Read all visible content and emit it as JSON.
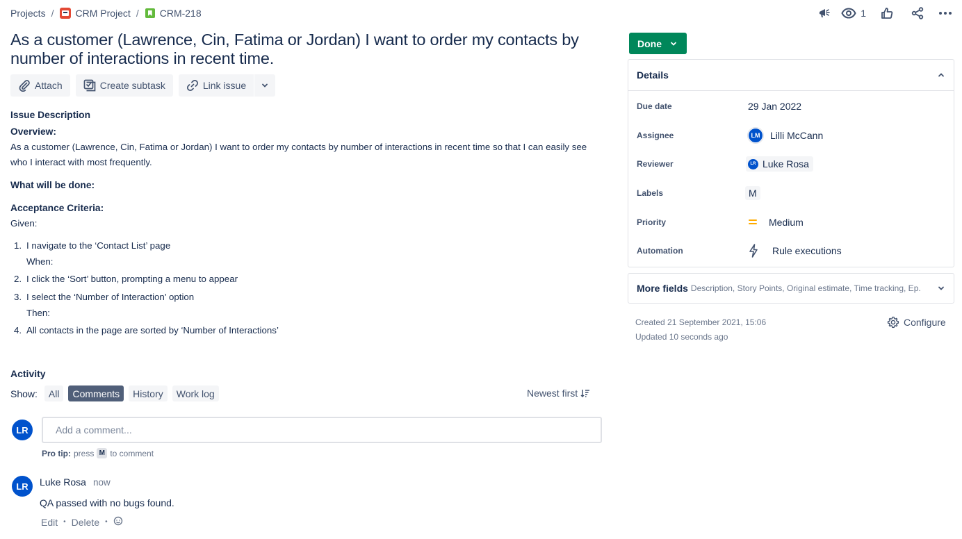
{
  "breadcrumb": {
    "projects": "Projects",
    "project": "CRM Project",
    "issue_key": "CRM-218",
    "separator": "/"
  },
  "header_actions": {
    "watch_count": "1"
  },
  "issue": {
    "title": "As a customer (Lawrence, Cin, Fatima or Jordan) I want to order my contacts by number of interactions in recent time."
  },
  "toolbar": {
    "attach": "Attach",
    "create_subtask": "Create subtask",
    "link_issue": "Link issue"
  },
  "description": {
    "heading": "Issue Description",
    "overview_label": "Overview:",
    "overview_text": "As a customer (Lawrence, Cin, Fatima or Jordan) I want to order my contacts by number of interactions in recent time so that I can easily see who I interact with most frequently.",
    "done_label": "What will be done:",
    "criteria_label": "Acceptance Criteria:",
    "given": "Given:",
    "steps": [
      {
        "num": "1.",
        "text": "I navigate to the ‘Contact List’ page",
        "sub": "When:"
      },
      {
        "num": "2.",
        "text": "I click the ‘Sort’ button, prompting a menu to appear",
        "sub": ""
      },
      {
        "num": "3.",
        "text": "I select the ‘Number of Interaction’ option",
        "sub": "Then:"
      },
      {
        "num": "4.",
        "text": "All contacts in the page are sorted by ‘Number of Interactions’",
        "sub": ""
      }
    ]
  },
  "activity": {
    "title": "Activity",
    "show_label": "Show:",
    "filters": [
      "All",
      "Comments",
      "History",
      "Work log"
    ],
    "active_filter": "Comments",
    "sort_label": "Newest first",
    "current_user_initials": "LR",
    "comment_placeholder": "Add a comment...",
    "protip_label": "Pro tip:",
    "protip_press": "press",
    "protip_key": "M",
    "protip_suffix": "to comment"
  },
  "comment": {
    "initials": "LR",
    "author": "Luke Rosa",
    "time": "now",
    "body": "QA passed with no bugs found.",
    "edit": "Edit",
    "delete": "Delete",
    "dot": "•"
  },
  "status": {
    "label": "Done",
    "color": "#00875a"
  },
  "details": {
    "title": "Details",
    "due_date_label": "Due date",
    "due_date": "29 Jan 2022",
    "assignee_label": "Assignee",
    "assignee_initials": "LM",
    "assignee": "Lilli McCann",
    "reviewer_label": "Reviewer",
    "reviewer_initials": "LR",
    "reviewer": "Luke Rosa",
    "labels_label": "Labels",
    "label_value": "M",
    "priority_label": "Priority",
    "priority": "Medium",
    "automation_label": "Automation",
    "automation": "Rule executions"
  },
  "more_fields": {
    "title": "More fields",
    "summary": "Description, Story Points, Original estimate, Time tracking, Ep..."
  },
  "meta": {
    "created": "Created 21 September 2021, 15:06",
    "updated": "Updated 10 seconds ago",
    "configure": "Configure"
  },
  "colors": {
    "brand_blue": "#0052cc",
    "text": "#172b4d",
    "subtle": "#42526e",
    "priority_medium": "#ffab00"
  }
}
